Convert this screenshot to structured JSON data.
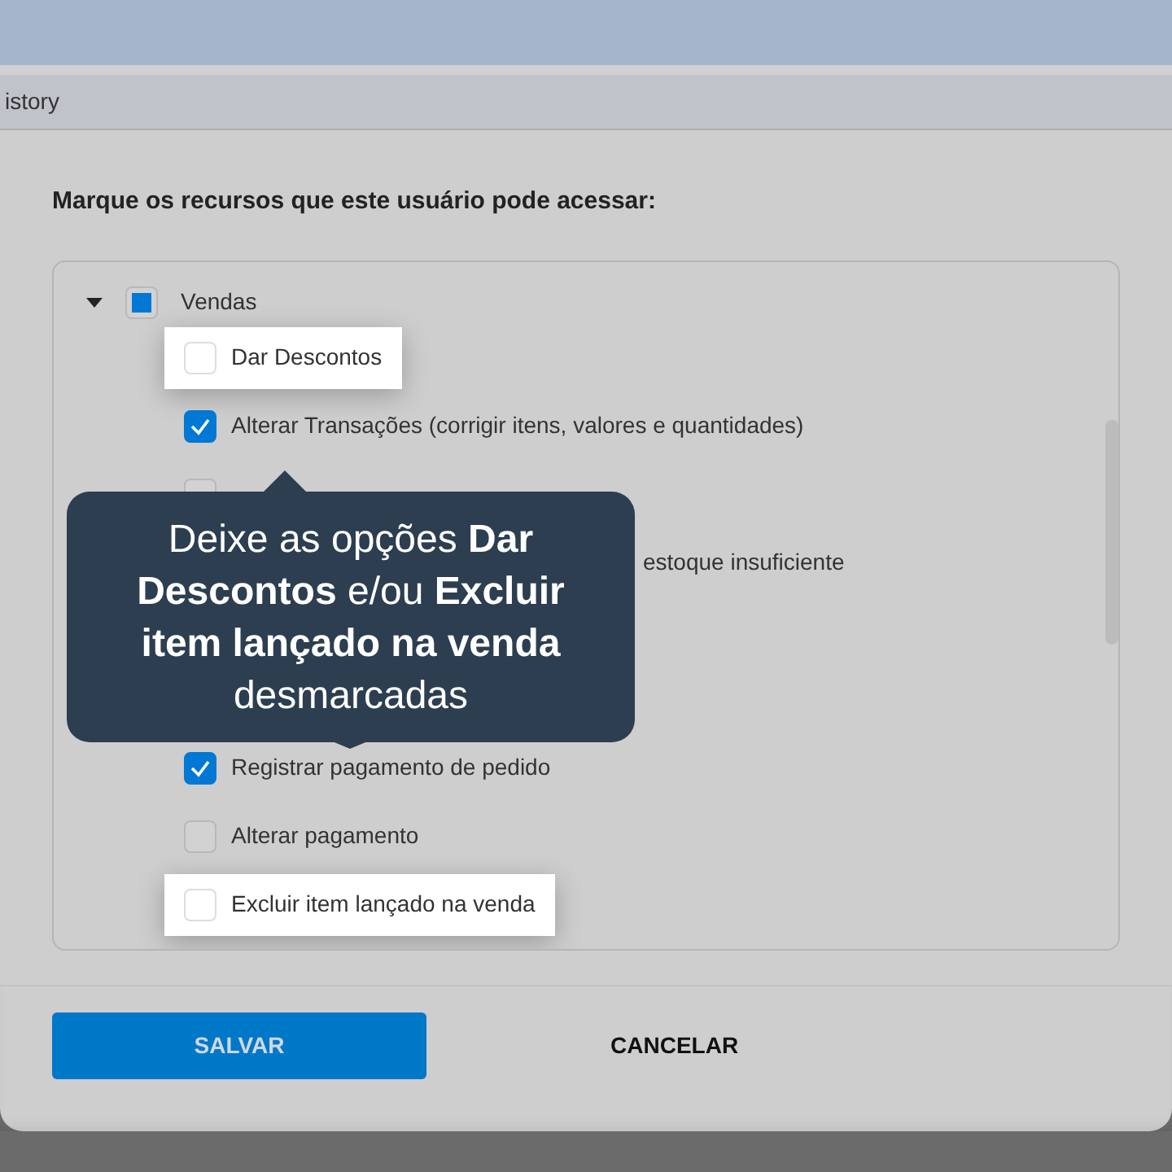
{
  "tab_bar": {
    "tab_label": "istory"
  },
  "heading": "Marque os recursos que este usuário pode acessar:",
  "tree": {
    "label": "Vendas",
    "expanded": true,
    "indeterminate": true,
    "children": [
      {
        "kind": "item",
        "label": "Dar Descontos",
        "checked": false,
        "highlighted": true
      },
      {
        "kind": "item",
        "label": "Alterar Transações (corrigir itens, valores e quantidades)",
        "checked": true,
        "highlighted": false
      },
      {
        "kind": "covered",
        "highlighted": false
      },
      {
        "kind": "partial",
        "label": "estoque insuficiente",
        "highlighted": false
      },
      {
        "kind": "hidden"
      },
      {
        "kind": "hidden"
      },
      {
        "kind": "item",
        "label": "Registrar pagamento de pedido",
        "checked": true,
        "highlighted": false
      },
      {
        "kind": "item",
        "label": "Alterar pagamento",
        "checked": false,
        "highlighted": false
      },
      {
        "kind": "item",
        "label": "Excluir item lançado na venda",
        "checked": false,
        "highlighted": true
      }
    ]
  },
  "tooltip": {
    "text": "Deixe as opções **Dar Descontos** e/ou **Excluir item lançado na venda** desmarcadas"
  },
  "buttons": [
    {
      "label": "SALVAR",
      "kind": "primary"
    },
    {
      "label": "CANCELAR",
      "kind": "text"
    }
  ]
}
